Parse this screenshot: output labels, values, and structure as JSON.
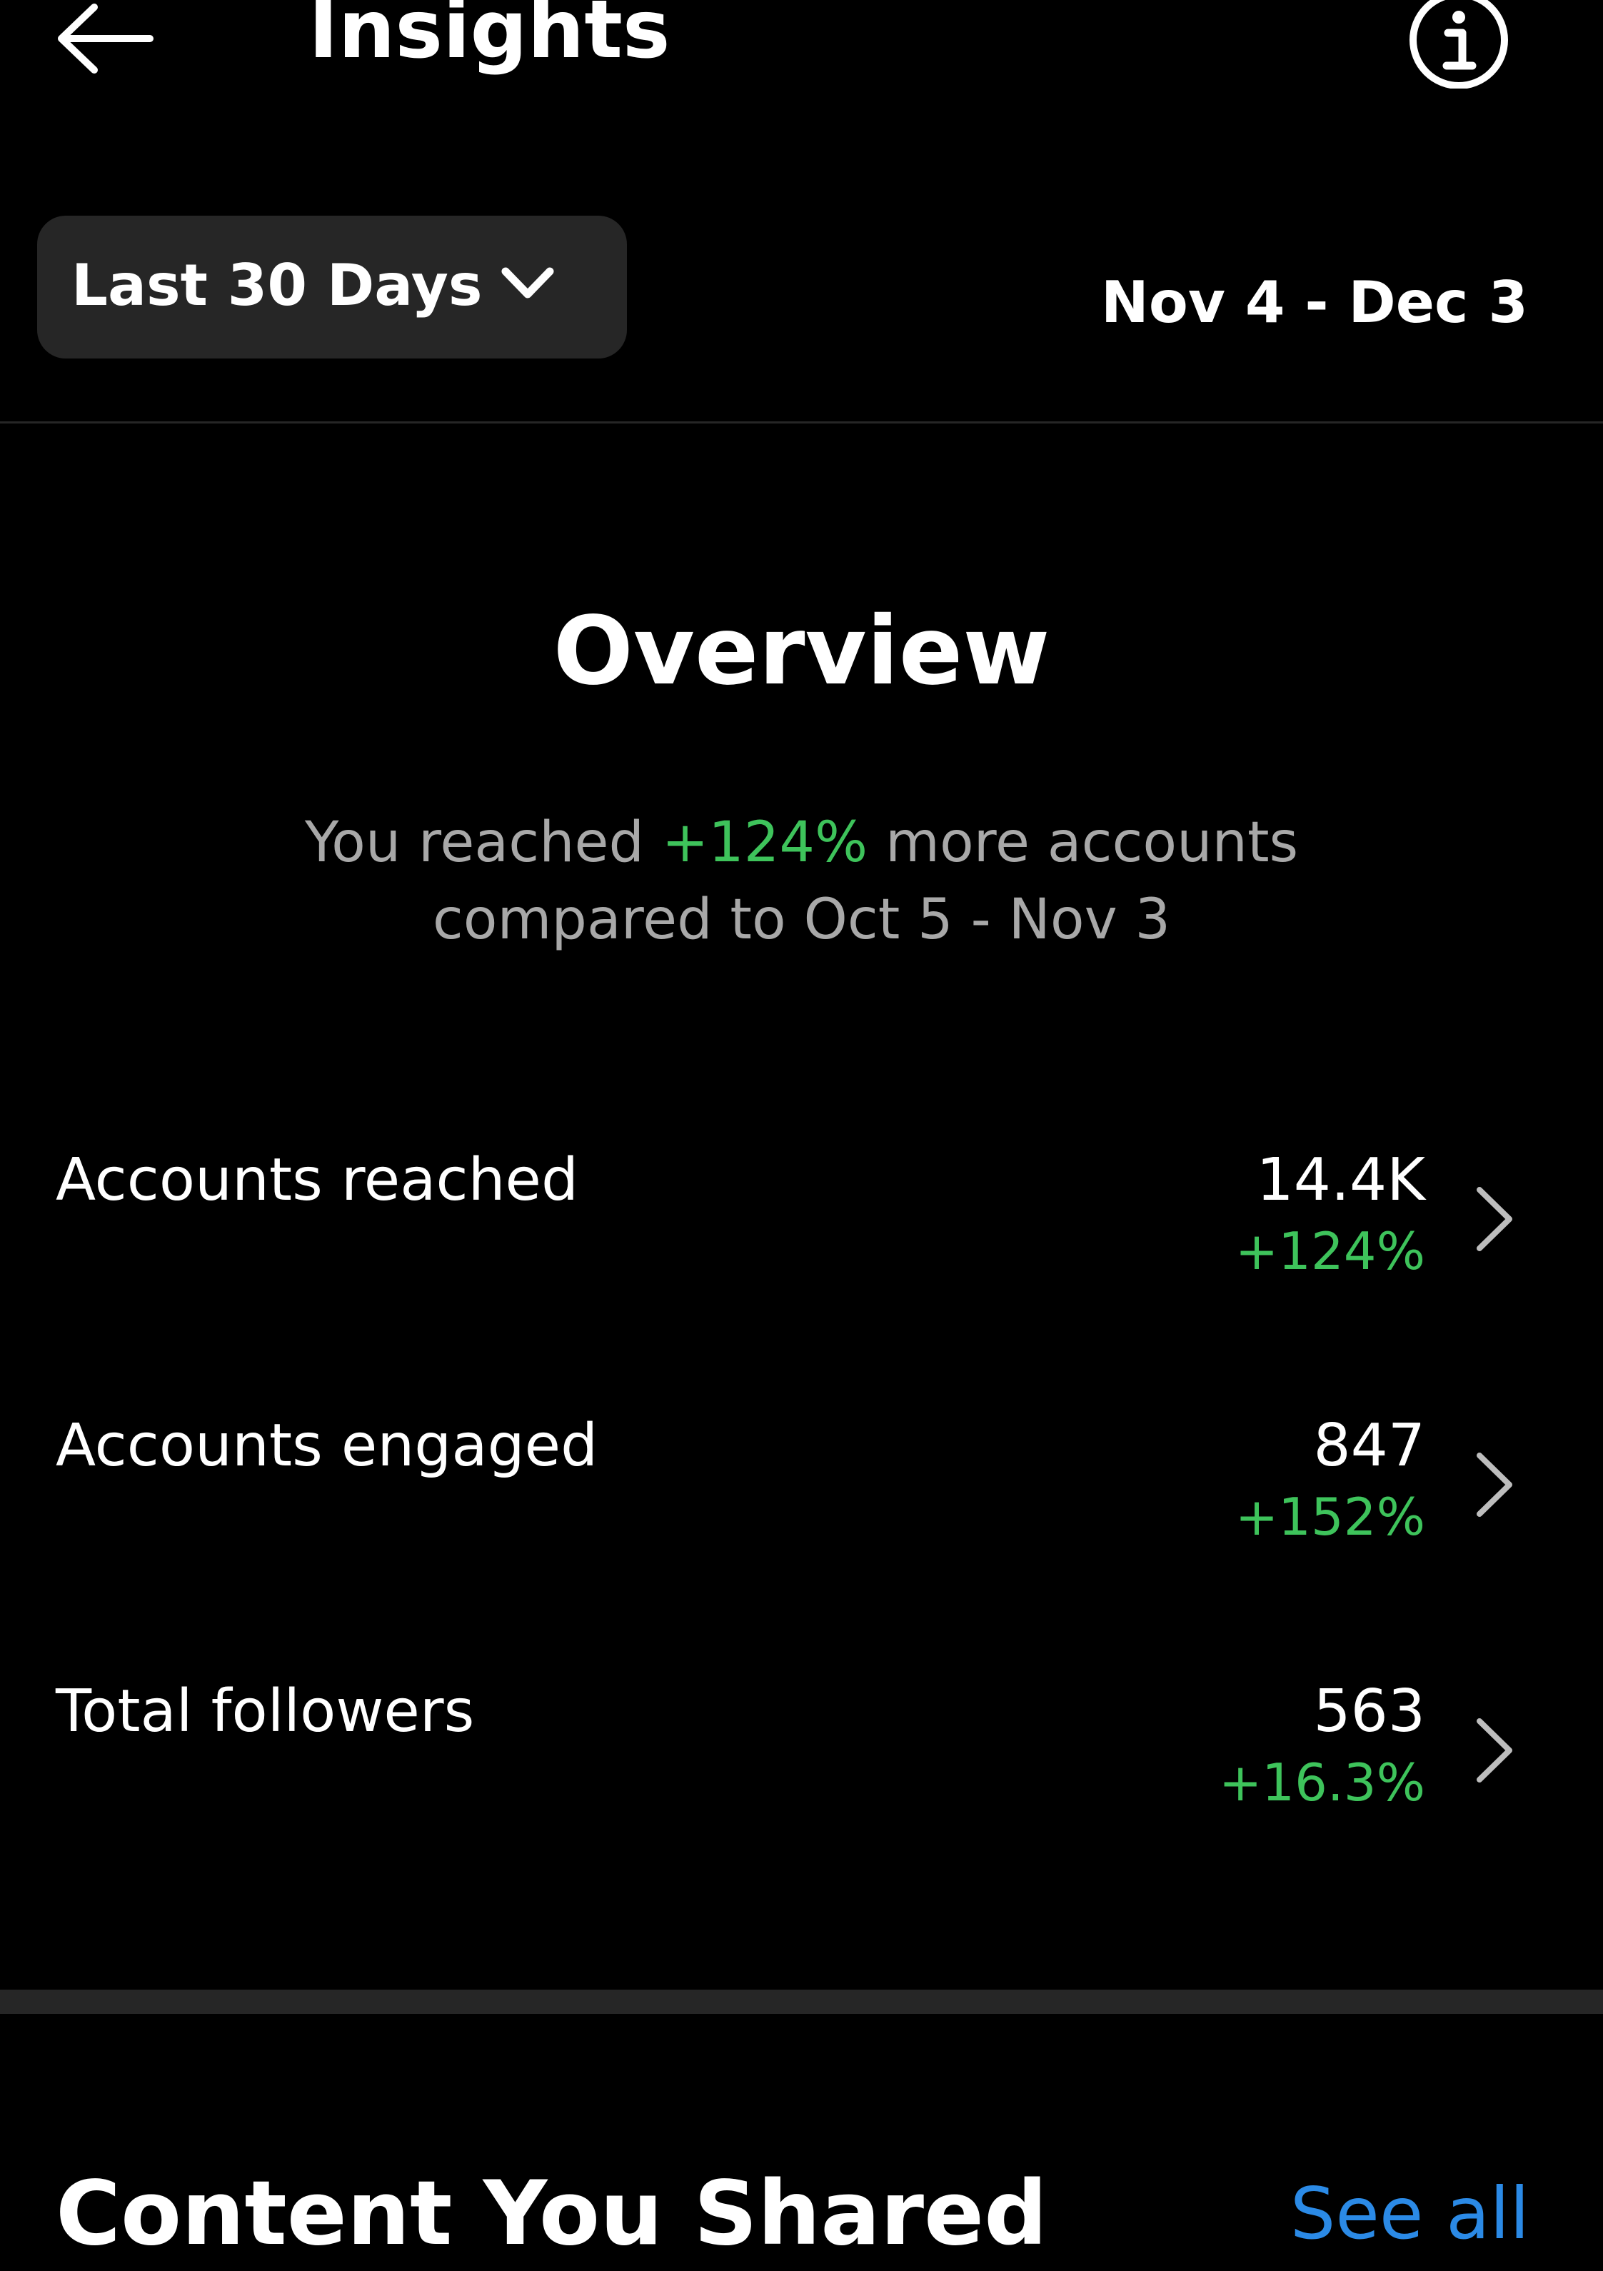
{
  "header": {
    "title": "Insights"
  },
  "range_selector": {
    "label": "Last 30 Days",
    "date_range": "Nov 4 - Dec 3"
  },
  "overview": {
    "title": "Overview",
    "summary_prefix": "You reached ",
    "summary_highlight": "+124%",
    "summary_suffix": " more accounts",
    "summary_line2": "compared to Oct 5 - Nov 3"
  },
  "metrics": [
    {
      "label": "Accounts reached",
      "value": "14.4K",
      "change": "+124%"
    },
    {
      "label": "Accounts engaged",
      "value": "847",
      "change": "+152%"
    },
    {
      "label": "Total followers",
      "value": "563",
      "change": "+16.3%"
    }
  ],
  "content_section": {
    "title": "Content You Shared",
    "see_all": "See all"
  },
  "colors": {
    "background": "#000000",
    "positive": "#3ec35b",
    "link": "#2b8ae6",
    "muted_text": "#a8a8a8",
    "surface": "#262626"
  },
  "icons": {
    "back": "arrow-left-icon",
    "info": "info-icon",
    "dropdown": "chevron-down-icon",
    "row": "chevron-right-icon"
  }
}
